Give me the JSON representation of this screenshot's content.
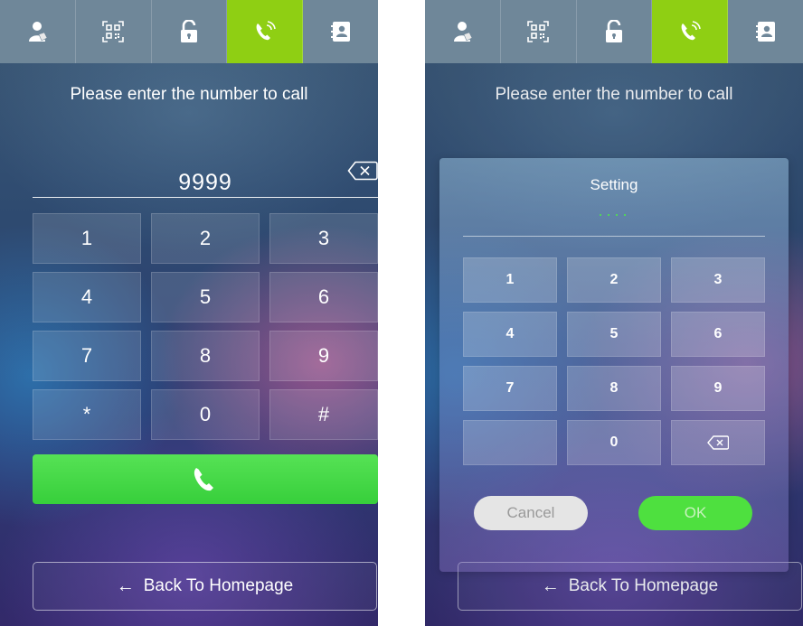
{
  "colors": {
    "active_tab": "#8fcf13",
    "topbar": "#6f8799",
    "call_green": "#3fd540",
    "ok_green": "#4ee03f",
    "cancel_gray": "#e5e5e5"
  },
  "tabs": [
    {
      "icon": "resident-icon"
    },
    {
      "icon": "qr-code-icon"
    },
    {
      "icon": "unlock-icon"
    },
    {
      "icon": "phone-call-icon",
      "active": true
    },
    {
      "icon": "contacts-icon"
    }
  ],
  "left": {
    "prompt": "Please enter the number to call",
    "number": "9999",
    "keys": [
      "1",
      "2",
      "3",
      "4",
      "5",
      "6",
      "7",
      "8",
      "9",
      "*",
      "0",
      "#"
    ],
    "back_label": "Back To Homepage",
    "back_arrow": "←"
  },
  "right": {
    "prompt": "Please enter the number to call",
    "back_label": "Back To Homepage",
    "back_arrow": "←",
    "dialog": {
      "title": "Setting",
      "masked_value": "····",
      "keys": [
        "1",
        "2",
        "3",
        "4",
        "5",
        "6",
        "7",
        "8",
        "9",
        "",
        "0",
        ""
      ],
      "cancel_label": "Cancel",
      "ok_label": "OK"
    }
  }
}
